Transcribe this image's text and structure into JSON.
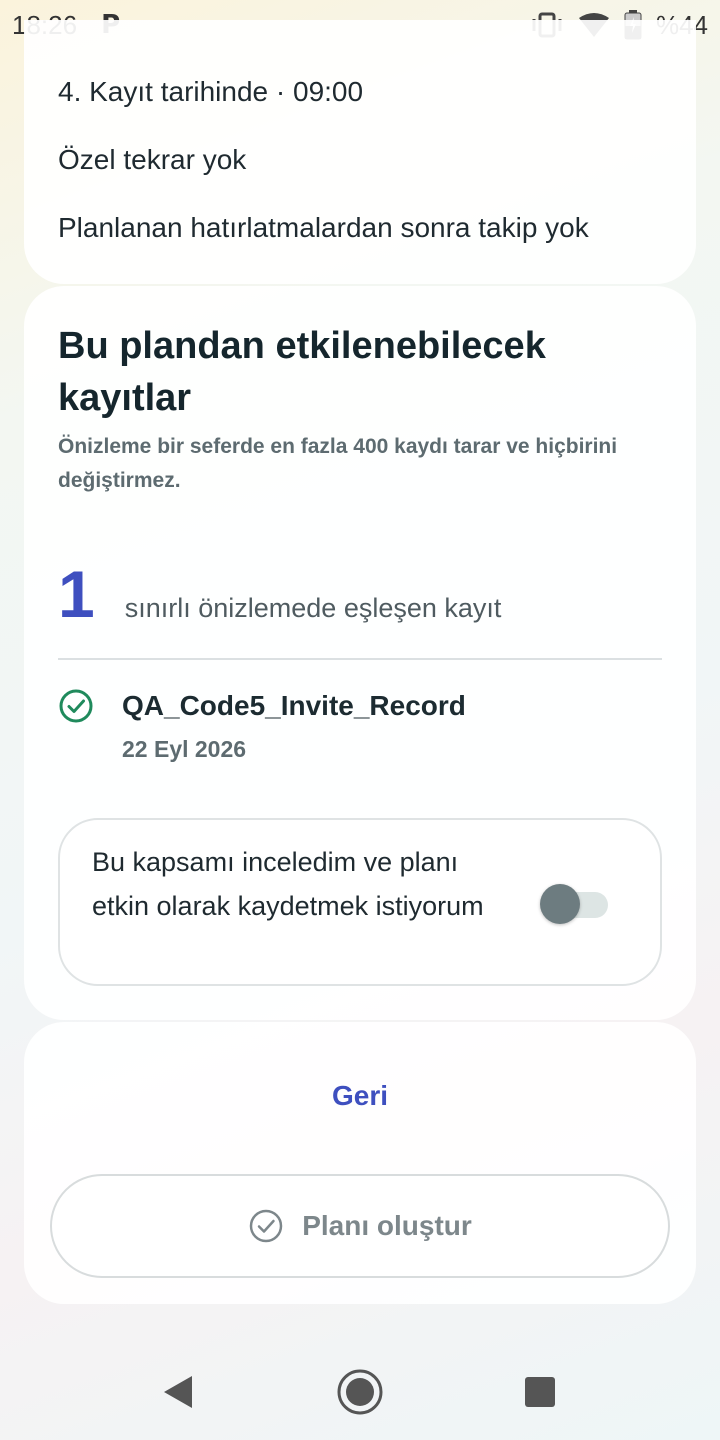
{
  "status_bar": {
    "time": "18:26",
    "notification_icon": "p-icon",
    "battery_percent": "%44",
    "icons": [
      "vibrate-icon",
      "wifi-icon",
      "battery-icon"
    ]
  },
  "schedule_card": {
    "line1": "4. Kayıt tarihinde · 09:00",
    "line2": "Özel tekrar yok",
    "line3": "Planlanan hatırlatmalardan sonra takip yok"
  },
  "preview_card": {
    "title": "Bu plandan etkilenebilecek kayıtlar",
    "subtitle": "Önizleme bir seferde en fazla 400 kaydı tarar ve hiçbirini değiştirmez.",
    "count": "1",
    "count_label": "sınırlı önizlemede eşleşen kayıt",
    "records": [
      {
        "name": "QA_Code5_Invite_Record",
        "date": "22 Eyl 2026"
      }
    ],
    "consent": {
      "label": "Bu kapsamı inceledim ve planı etkin olarak kaydetmek istiyorum",
      "checked": false
    }
  },
  "actions": {
    "back_label": "Geri",
    "create_label": "Planı oluştur"
  },
  "colors": {
    "accent": "#3e4fbf",
    "success": "#1f8a5c",
    "muted_text": "#5d6b70"
  }
}
